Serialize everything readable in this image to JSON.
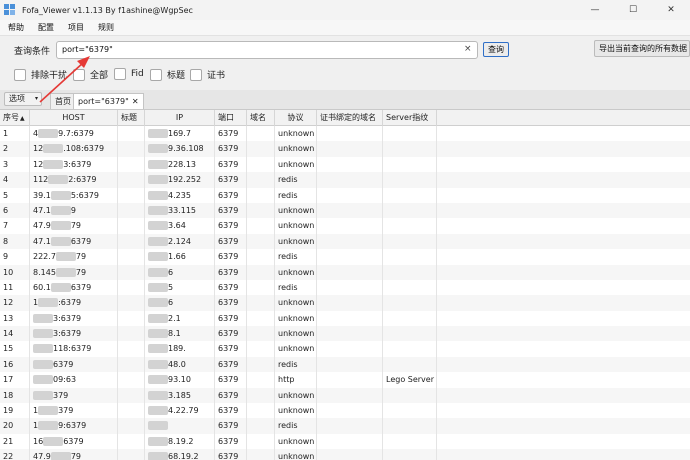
{
  "window": {
    "title": "Fofa_Viewer v1.1.13 By f1ashine@WgpSec",
    "controls": [
      "—",
      "☐",
      "✕"
    ]
  },
  "menu": {
    "items": [
      "帮助",
      "配置",
      "项目",
      "规则"
    ]
  },
  "query": {
    "label": "查询条件",
    "value": "port=\"6379\"",
    "clear": "×",
    "search_btn": "查询",
    "export_btn": "导出当前查询的所有数据"
  },
  "filters": [
    {
      "label": "排除干扰"
    },
    {
      "label": "全部"
    },
    {
      "label": "Fid"
    },
    {
      "label": "标题"
    },
    {
      "label": "证书"
    }
  ],
  "tabs": {
    "options_btn": "选项",
    "caret": "▾",
    "home": "首页",
    "active": "port=\"6379\"",
    "close": "✕"
  },
  "table": {
    "headers": [
      "序号",
      "HOST",
      "标题",
      "IP",
      "端口",
      "域名",
      "协议",
      "证书绑定的域名",
      "Server指纹"
    ],
    "sort_indicator": "▲",
    "rows": [
      {
        "idx": "1",
        "host_a": "4",
        "host_b": "9.7:6379",
        "ip_b": "169.7",
        "port": "6379",
        "proto": "unknown",
        "server": ""
      },
      {
        "idx": "2",
        "host_a": "12",
        "host_b": ".108:6379",
        "ip_b": "9.36.108",
        "port": "6379",
        "proto": "unknown",
        "server": ""
      },
      {
        "idx": "3",
        "host_a": "12",
        "host_b": "3:6379",
        "ip_b": "228.13",
        "port": "6379",
        "proto": "unknown",
        "server": ""
      },
      {
        "idx": "4",
        "host_a": "112",
        "host_b": "2:6379",
        "ip_b": "192.252",
        "port": "6379",
        "proto": "redis",
        "server": ""
      },
      {
        "idx": "5",
        "host_a": "39.1",
        "host_b": "5:6379",
        "ip_b": "4.235",
        "port": "6379",
        "proto": "redis",
        "server": ""
      },
      {
        "idx": "6",
        "host_a": "47.1",
        "host_b": "9",
        "ip_b": "33.115",
        "port": "6379",
        "proto": "unknown",
        "server": ""
      },
      {
        "idx": "7",
        "host_a": "47.9",
        "host_b": "79",
        "ip_b": "3.64",
        "port": "6379",
        "proto": "unknown",
        "server": ""
      },
      {
        "idx": "8",
        "host_a": "47.1",
        "host_b": "6379",
        "ip_b": "2.124",
        "port": "6379",
        "proto": "unknown",
        "server": ""
      },
      {
        "idx": "9",
        "host_a": "222.7",
        "host_b": "79",
        "ip_b": "1.66",
        "port": "6379",
        "proto": "redis",
        "server": ""
      },
      {
        "idx": "10",
        "host_a": "8.145",
        "host_b": "79",
        "ip_b": "6",
        "port": "6379",
        "proto": "unknown",
        "server": ""
      },
      {
        "idx": "11",
        "host_a": "60.1",
        "host_b": "6379",
        "ip_b": "5",
        "port": "6379",
        "proto": "redis",
        "server": ""
      },
      {
        "idx": "12",
        "host_a": "1",
        "host_b": ":6379",
        "ip_b": "6",
        "port": "6379",
        "proto": "unknown",
        "server": ""
      },
      {
        "idx": "13",
        "host_a": "",
        "host_b": "3:6379",
        "ip_b": "2.1",
        "port": "6379",
        "proto": "unknown",
        "server": ""
      },
      {
        "idx": "14",
        "host_a": "",
        "host_b": "3:6379",
        "ip_b": "8.1",
        "port": "6379",
        "proto": "unknown",
        "server": ""
      },
      {
        "idx": "15",
        "host_a": "",
        "host_b": "118:6379",
        "ip_b": "189.",
        "port": "6379",
        "proto": "unknown",
        "server": ""
      },
      {
        "idx": "16",
        "host_a": "",
        "host_b": "6379",
        "ip_b": "48.0",
        "port": "6379",
        "proto": "redis",
        "server": ""
      },
      {
        "idx": "17",
        "host_a": "",
        "host_b": "09:63",
        "ip_b": "93.10",
        "port": "6379",
        "proto": "http",
        "server": "Lego Server"
      },
      {
        "idx": "18",
        "host_a": "",
        "host_b": "379",
        "ip_b": "3.185",
        "port": "6379",
        "proto": "unknown",
        "server": ""
      },
      {
        "idx": "19",
        "host_a": "1",
        "host_b": "379",
        "ip_b": "4.22.79",
        "port": "6379",
        "proto": "unknown",
        "server": ""
      },
      {
        "idx": "20",
        "host_a": "1",
        "host_b": "9:6379",
        "ip_b": "",
        "port": "6379",
        "proto": "redis",
        "server": ""
      },
      {
        "idx": "21",
        "host_a": "16",
        "host_b": "6379",
        "ip_b": "8.19.2",
        "port": "6379",
        "proto": "unknown",
        "server": ""
      },
      {
        "idx": "22",
        "host_a": "47.9",
        "host_b": "79",
        "ip_b": "68.19.2",
        "port": "6379",
        "proto": "unknown",
        "server": ""
      }
    ]
  },
  "colors": {
    "accent": "#2f6fc7",
    "annotation": "#e53935"
  },
  "annotation": {
    "arrow_icon": "red-arrow-icon"
  }
}
